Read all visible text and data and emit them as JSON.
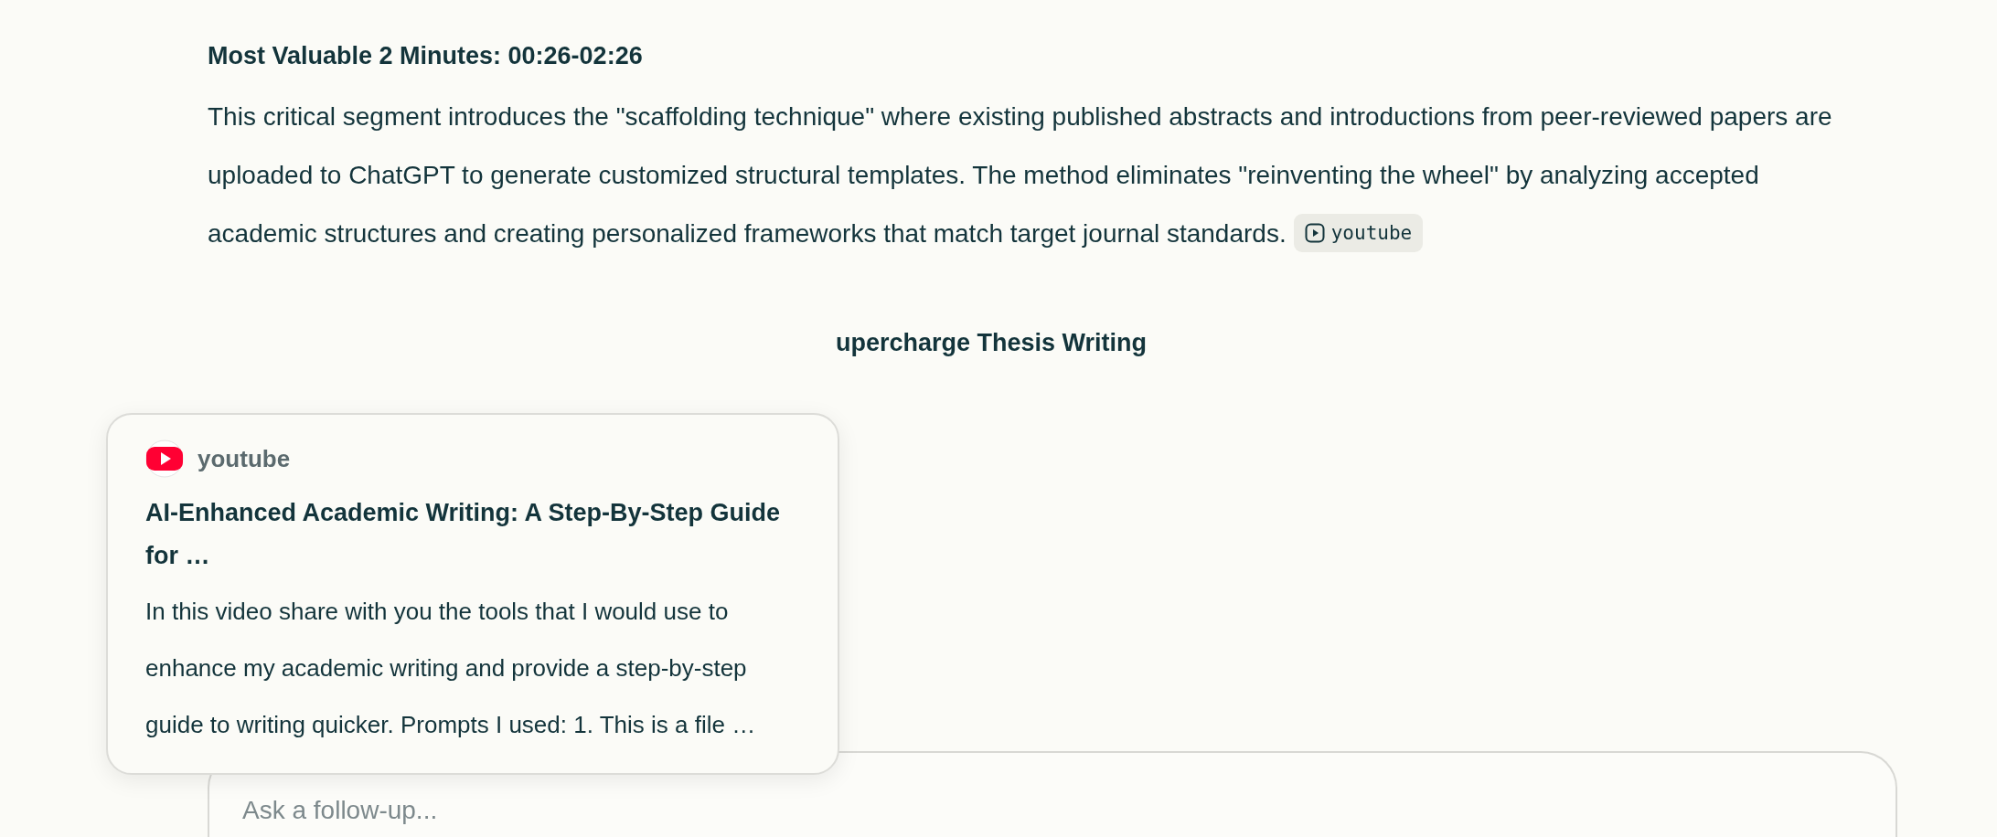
{
  "section": {
    "heading": "Most Valuable 2 Minutes: 00:26-02:26",
    "paragraph": "This critical segment introduces the \"scaffolding technique\" where existing published abstracts and introductions from peer-reviewed papers are uploaded to ChatGPT to generate customized structural templates. The method eliminates \"reinventing the wheel\" by analyzing accepted academic structures and creating personalized frameworks that match target journal standards.",
    "citation": {
      "label": "youtube"
    }
  },
  "next_heading": "upercharge Thesis Writing",
  "source_popup": {
    "source": "youtube",
    "title": "AI-Enhanced Academic Writing: A Step-By-Step Guide for …",
    "description": "In this video share with you the tools that I would use to enhance my academic writing and provide a step-by-step guide to writing quicker. Prompts I used: 1. This is a file …"
  },
  "follow_up": {
    "placeholder": "Ask a follow-up..."
  }
}
